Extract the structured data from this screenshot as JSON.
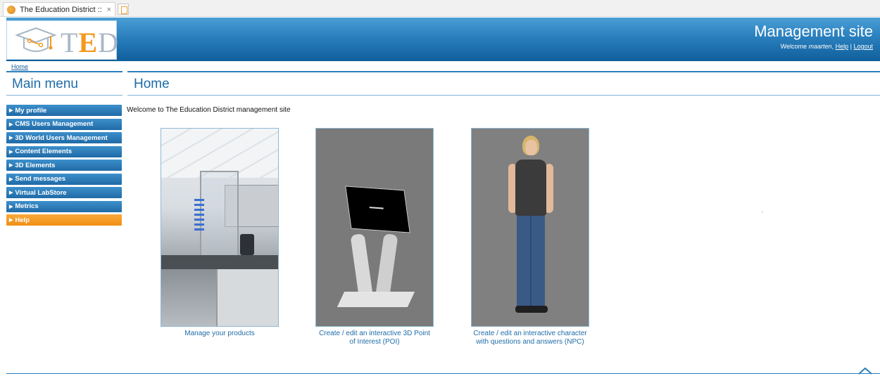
{
  "browser": {
    "tab_title": "The Education District :: Ma...",
    "tab_close": "×",
    "favicon": "orange-circle-icon"
  },
  "header": {
    "logo_text_t": "T",
    "logo_text_e": "E",
    "logo_text_d": "D",
    "site_title": "Management site",
    "welcome_prefix": "Welcome ",
    "username": "maarten",
    "help_link": "Help",
    "separator": "|",
    "logout_link": "Logout",
    "colors": {
      "header": "#1e6ca8",
      "accent": "#f39a1f"
    }
  },
  "breadcrumb": "Home",
  "menu": {
    "title": "Main menu",
    "items": [
      {
        "label": "My profile"
      },
      {
        "label": "CMS Users Management"
      },
      {
        "label": "3D World Users Management"
      },
      {
        "label": "Content Elements"
      },
      {
        "label": "3D Elements"
      },
      {
        "label": "Send messages"
      },
      {
        "label": "Virtual LabStore"
      },
      {
        "label": "Metrics"
      },
      {
        "label": "Help",
        "active": true
      }
    ]
  },
  "main": {
    "title": "Home",
    "intro": "Welcome to The Education District management site",
    "cards": [
      {
        "caption": "Manage your products",
        "image": "laboratory-image"
      },
      {
        "caption_line1": "Create / edit an interactive 3D Point",
        "caption_line2": "of Interest (POI)",
        "image": "kiosk-stand-image"
      },
      {
        "caption_line1": "Create / edit an interactive character",
        "caption_line2": "with questions and answers (NPC)",
        "image": "npc-character-image"
      }
    ]
  }
}
